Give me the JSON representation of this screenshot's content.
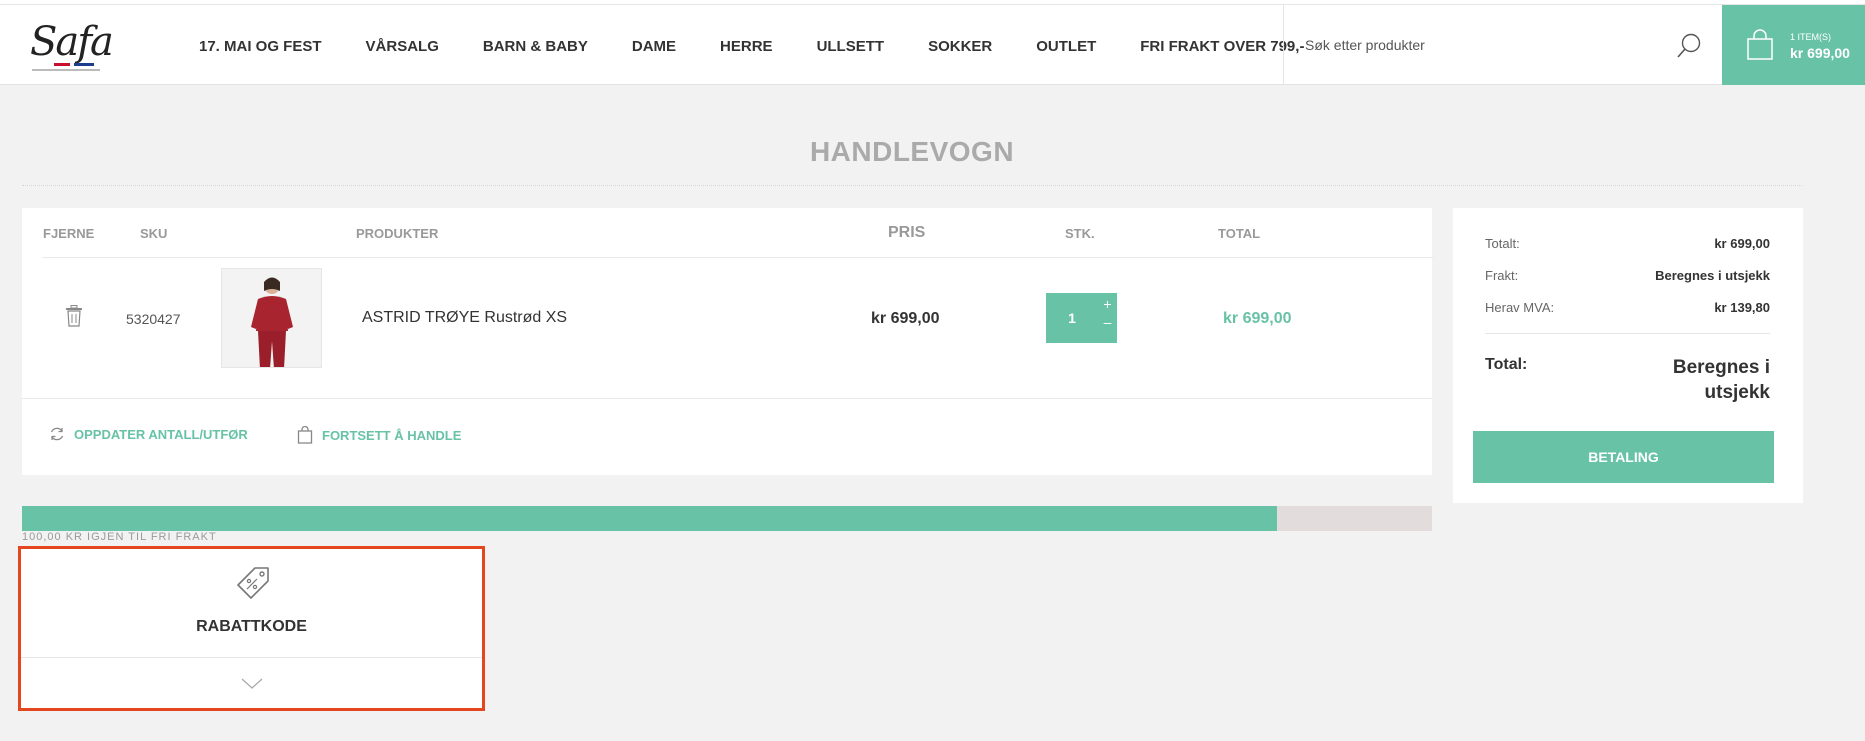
{
  "header": {
    "logo_text": "Safa",
    "nav": [
      "17. MAI OG FEST",
      "VÅRSALG",
      "BARN & BABY",
      "DAME",
      "HERRE",
      "ULLSETT",
      "SOKKER",
      "OUTLET",
      "FRI FRAKT OVER 799,-"
    ],
    "search_placeholder": "Søk etter produkter",
    "search_icon": "search-icon",
    "cart_count": "1 ITEM(S)",
    "cart_amount": "kr 699,00",
    "cart_icon": "bag-icon"
  },
  "page": {
    "title": "HANDLEVOGN"
  },
  "cart_table": {
    "headers": {
      "remove": "FJERNE",
      "sku": "SKU",
      "product": "PRODUKTER",
      "price": "PRIS",
      "qty": "STK.",
      "total": "TOTAL"
    },
    "rows": [
      {
        "sku": "5320427",
        "name": "ASTRID TRØYE Rustrød XS",
        "price": "kr 699,00",
        "qty": "1",
        "total": "kr 699,00"
      }
    ],
    "actions": {
      "update": "OPPDATER ANTALL/UTFØR",
      "continue": "FORTSETT Å HANDLE"
    }
  },
  "summary": {
    "rows": [
      {
        "label": "Totalt:",
        "value": "kr 699,00"
      },
      {
        "label": "Frakt:",
        "value": "Beregnes i utsjekk"
      },
      {
        "label": "Herav MVA:",
        "value": "kr 139,80"
      }
    ],
    "total_label": "Total:",
    "total_value": "Beregnes i utsjekk",
    "checkout_button": "BETALING"
  },
  "shipping": {
    "text": "100,00 KR IGJEN TIL FRI FRAKT",
    "progress_fraction": 0.89
  },
  "discount": {
    "title": "RABATTKODE"
  },
  "colors": {
    "accent": "#68c2a6",
    "highlight": "#e4461f",
    "background": "#f2f2f2"
  }
}
